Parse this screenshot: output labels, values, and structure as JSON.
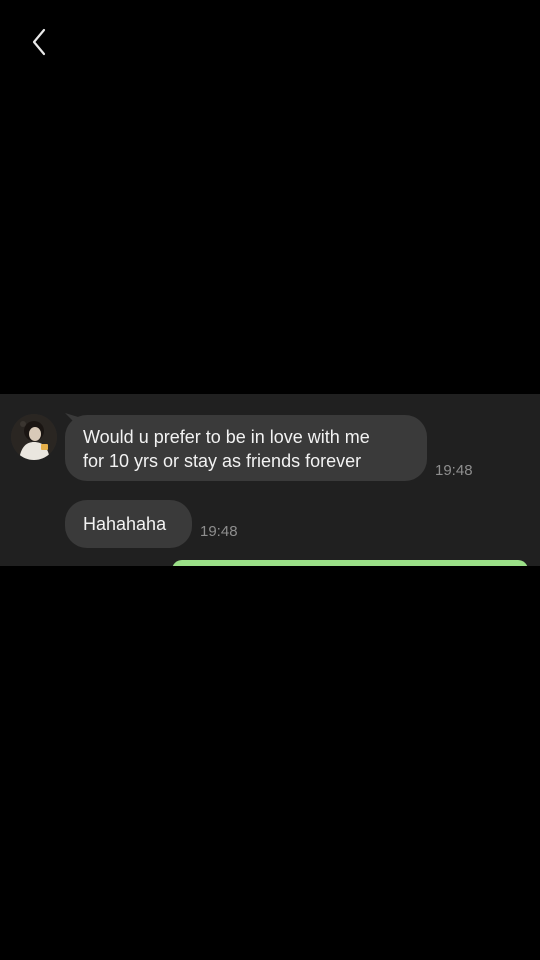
{
  "navigation": {
    "back_icon": "chevron-left-icon"
  },
  "chat": {
    "contact_avatar": "contact-avatar",
    "messages": [
      {
        "direction": "incoming",
        "lines": [
          "Would u prefer to be in love with me",
          "for 10 yrs or stay as friends forever"
        ],
        "time": "19:48"
      },
      {
        "direction": "incoming",
        "text": "Hahahaha",
        "time": "19:48"
      }
    ]
  },
  "colors": {
    "background": "#000000",
    "chat_background": "#202020",
    "incoming_bubble": "#3a3a3a",
    "outgoing_bubble": "#9be088",
    "timestamp": "#8e8e8e"
  }
}
